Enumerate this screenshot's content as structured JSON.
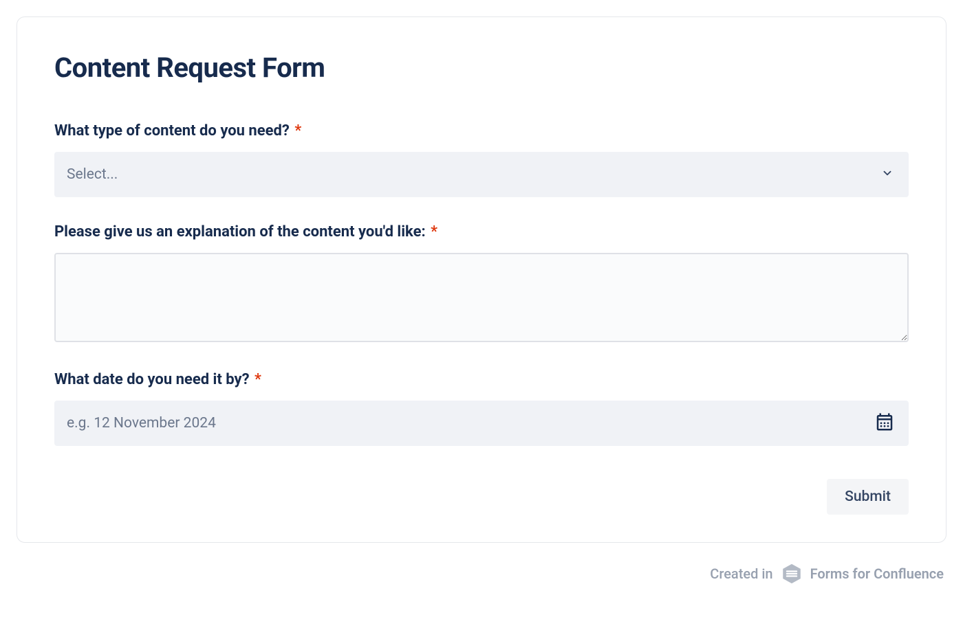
{
  "form": {
    "title": "Content Request Form",
    "fields": {
      "contentType": {
        "label": "What type of content do you need?",
        "placeholder": "Select...",
        "required": true
      },
      "explanation": {
        "label": "Please give us an explanation of the content you'd like:",
        "required": true
      },
      "dueDate": {
        "label": "What date do you need it by?",
        "placeholder": "e.g. 12 November 2024",
        "required": true
      }
    },
    "submit_label": "Submit",
    "required_symbol": "*"
  },
  "footer": {
    "created_in": "Created in",
    "brand": "Forms for Confluence"
  }
}
